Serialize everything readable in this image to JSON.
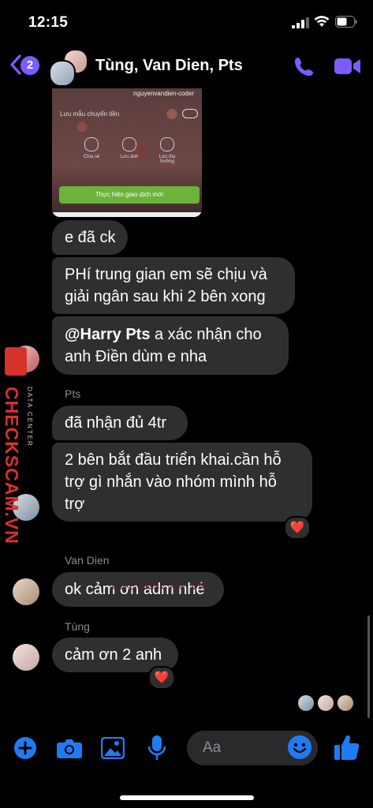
{
  "status": {
    "time": "12:15"
  },
  "header": {
    "back_count": "2",
    "title": "Tùng, Van Dien, Pts"
  },
  "shared_screenshot": {
    "top_label": "nguyenvandien-coder",
    "save_label": "Lưu mẫu chuyển tiền",
    "actions": [
      "Chia sẻ",
      "Lưu ảnh",
      "Lưu thụ hưởng"
    ],
    "cta": "Thực hiện giao dịch mới"
  },
  "messages": {
    "m1": "e đã ck",
    "m2_line1": "PHí trung gian em sẽ chịu và",
    "m2_line2": "giải ngân sau khi 2 bên xong",
    "m3_mention": "@Harry Pts",
    "m3_rest": " a xác nhận cho",
    "m3_line2": "anh Điền dùm e nha",
    "sender_pts": "Pts",
    "m4": "đã nhận đủ 4tr",
    "m5_line1": "2 bên bắt đầu triển khai.cần hỗ",
    "m5_line2": "trợ gì nhắn vào nhóm mình hỗ",
    "m5_line3": "trợ",
    "sender_vandien": "Van Dien",
    "m6": "ok cảm ơn adm nhé",
    "sender_tung": "Tùng",
    "m7": "cảm ơn 2 anh"
  },
  "reactions": {
    "heart": "❤️"
  },
  "watermark": {
    "side_brand": "CHECKSCAM.VN",
    "side_sub": "DATA CENTER",
    "center": "CHECKSCAM.VN"
  },
  "composer": {
    "placeholder": "Aa"
  },
  "colors": {
    "accent": "#7c5cff",
    "blue": "#1e7cf2",
    "bubble": "#2f2f31"
  }
}
